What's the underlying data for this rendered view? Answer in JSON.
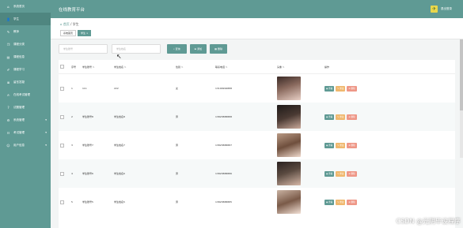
{
  "sidebar": {
    "items": [
      {
        "icon": "home-icon",
        "glyph": "⌂",
        "label": "系统首页",
        "active": false
      },
      {
        "icon": "user-icon",
        "glyph": "👤",
        "label": "学生",
        "active": true
      },
      {
        "icon": "teacher-icon",
        "glyph": "✎",
        "label": "教师",
        "active": false
      },
      {
        "icon": "book-icon",
        "glyph": "❐",
        "label": "课程分类",
        "active": false
      },
      {
        "icon": "course-icon",
        "glyph": "▤",
        "label": "课程信息",
        "active": false
      },
      {
        "icon": "study-icon",
        "glyph": "✐",
        "label": "课程学习",
        "active": false
      },
      {
        "icon": "doc-icon",
        "glyph": "≣",
        "label": "留言答疑",
        "active": false
      },
      {
        "icon": "exam-icon",
        "glyph": "✍",
        "label": "在线考试管理",
        "active": false
      },
      {
        "icon": "question-icon",
        "glyph": "?",
        "label": "试题管理",
        "active": false
      },
      {
        "icon": "system-icon",
        "glyph": "⚙",
        "label": "系统管理",
        "active": false,
        "arrow": "▾"
      },
      {
        "icon": "record-icon",
        "glyph": "☷",
        "label": "考试管理",
        "active": false,
        "arrow": "▾"
      },
      {
        "icon": "profile-icon",
        "glyph": "☺",
        "label": "用户信息",
        "active": false,
        "arrow": "▾"
      }
    ]
  },
  "topbar": {
    "title": "在线教育平台",
    "user_label": "退出登录"
  },
  "breadcrumb": {
    "home": "首页",
    "separator": "/",
    "current": "学生"
  },
  "tags": [
    {
      "label": "系统首页",
      "active": false
    },
    {
      "label": "学生 ×",
      "active": true
    }
  ],
  "search": {
    "account_placeholder": "学生账号",
    "name_placeholder": "学生姓名",
    "search_label": "查询",
    "add_label": "添加",
    "delete_label": "删除"
  },
  "table": {
    "headers": {
      "index": "序号",
      "account": "学生账号",
      "name": "学生姓名",
      "gender": "性别",
      "phone": "联系电话",
      "photo": "头像",
      "ops": "操作"
    },
    "sort_glyph": "⇅",
    "rows": [
      {
        "index": "1",
        "account": "111",
        "name": "222",
        "gender": "女",
        "phone": "13199999888"
      },
      {
        "index": "2",
        "account": "学生账号8",
        "name": "学生姓名8",
        "gender": "男",
        "phone": "13823888888"
      },
      {
        "index": "3",
        "account": "学生账号7",
        "name": "学生姓名7",
        "gender": "男",
        "phone": "13823888887"
      },
      {
        "index": "4",
        "account": "学生账号6",
        "name": "学生姓名6",
        "gender": "男",
        "phone": "13823888886"
      },
      {
        "index": "5",
        "account": "学生账号5",
        "name": "学生姓名5",
        "gender": "男",
        "phone": "13823888885"
      }
    ],
    "ops": {
      "view": "查看",
      "edit": "修改",
      "delete": "删除"
    }
  },
  "watermark": "CSDN @光阴毕设程序",
  "colors": {
    "accent": "#5f9a94",
    "edit": "#f0b86e",
    "delete": "#ee9787"
  }
}
